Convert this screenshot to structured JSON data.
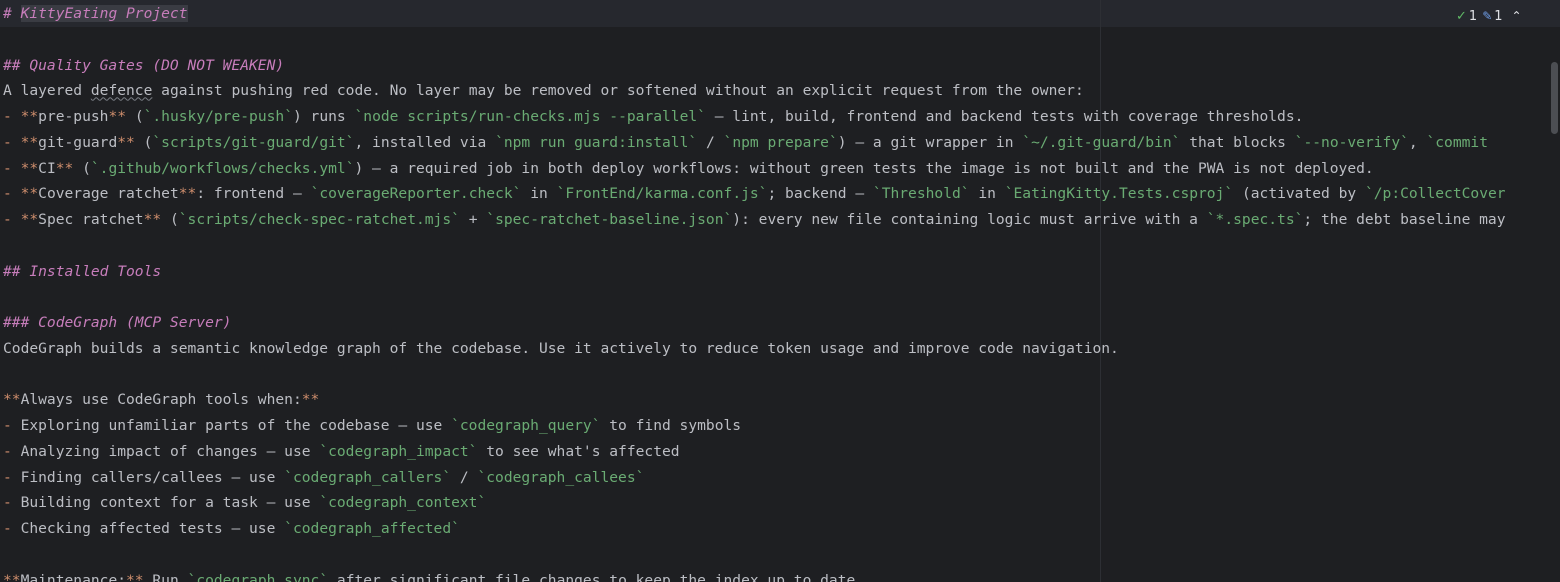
{
  "editor": {
    "lines": [
      [
        {
          "t": "# ",
          "c": "hdr"
        },
        {
          "t": "KittyEating Project",
          "c": "hdr sel"
        }
      ],
      [],
      [
        {
          "t": "## Quality Gates (DO NOT WEAKEN)",
          "c": "hdr"
        }
      ],
      [
        {
          "t": "A layered "
        },
        {
          "t": "defence",
          "c": "uline"
        },
        {
          "t": " against pushing red code. No layer may be removed or softened without an explicit request from the owner:"
        }
      ],
      [
        {
          "t": "- ",
          "c": "mk"
        },
        {
          "t": "**",
          "c": "mk"
        },
        {
          "t": "pre-push"
        },
        {
          "t": "**",
          "c": "mk"
        },
        {
          "t": " ("
        },
        {
          "t": "`.husky/pre-push`",
          "c": "code"
        },
        {
          "t": ") runs "
        },
        {
          "t": "`node scripts/run-checks.mjs --parallel`",
          "c": "code"
        },
        {
          "t": " — lint, build, frontend and backend tests with coverage thresholds."
        }
      ],
      [
        {
          "t": "- ",
          "c": "mk"
        },
        {
          "t": "**",
          "c": "mk"
        },
        {
          "t": "git-guard"
        },
        {
          "t": "**",
          "c": "mk"
        },
        {
          "t": " ("
        },
        {
          "t": "`scripts/git-guard/git`",
          "c": "code"
        },
        {
          "t": ", installed via "
        },
        {
          "t": "`npm run guard:install`",
          "c": "code"
        },
        {
          "t": " / "
        },
        {
          "t": "`npm prepare`",
          "c": "code"
        },
        {
          "t": ") — a git wrapper in "
        },
        {
          "t": "`~/.git-guard/bin`",
          "c": "code"
        },
        {
          "t": " that blocks "
        },
        {
          "t": "`--no-verify`",
          "c": "code"
        },
        {
          "t": ", "
        },
        {
          "t": "`commit",
          "c": "code"
        }
      ],
      [
        {
          "t": "- ",
          "c": "mk"
        },
        {
          "t": "**",
          "c": "mk"
        },
        {
          "t": "CI"
        },
        {
          "t": "**",
          "c": "mk"
        },
        {
          "t": " ("
        },
        {
          "t": "`.github/workflows/checks.yml`",
          "c": "code"
        },
        {
          "t": ") — a required job in both deploy workflows: without green tests the image is not built and the PWA is not deployed."
        }
      ],
      [
        {
          "t": "- ",
          "c": "mk"
        },
        {
          "t": "**",
          "c": "mk"
        },
        {
          "t": "Coverage ratchet"
        },
        {
          "t": "**",
          "c": "mk"
        },
        {
          "t": ": frontend — "
        },
        {
          "t": "`coverageReporter.check`",
          "c": "code"
        },
        {
          "t": " in "
        },
        {
          "t": "`FrontEnd/karma.conf.js`",
          "c": "code"
        },
        {
          "t": "; backend — "
        },
        {
          "t": "`Threshold`",
          "c": "code"
        },
        {
          "t": " in "
        },
        {
          "t": "`EatingKitty.Tests.csproj`",
          "c": "code"
        },
        {
          "t": " (activated by "
        },
        {
          "t": "`/p:CollectCover",
          "c": "code"
        }
      ],
      [
        {
          "t": "- ",
          "c": "mk"
        },
        {
          "t": "**",
          "c": "mk"
        },
        {
          "t": "Spec ratchet"
        },
        {
          "t": "**",
          "c": "mk"
        },
        {
          "t": " ("
        },
        {
          "t": "`scripts/check-spec-ratchet.mjs`",
          "c": "code"
        },
        {
          "t": " + "
        },
        {
          "t": "`spec-ratchet-baseline.json`",
          "c": "code"
        },
        {
          "t": "): every new file containing logic must arrive with a "
        },
        {
          "t": "`*.spec.ts`",
          "c": "code"
        },
        {
          "t": "; the debt baseline may"
        }
      ],
      [],
      [
        {
          "t": "## Installed Tools",
          "c": "hdr"
        }
      ],
      [],
      [
        {
          "t": "### CodeGraph (MCP Server)",
          "c": "hdr"
        }
      ],
      [
        {
          "t": "CodeGraph builds a semantic knowledge graph of the codebase. Use it actively to reduce token usage and improve code navigation."
        }
      ],
      [],
      [
        {
          "t": "**",
          "c": "mk"
        },
        {
          "t": "Always use CodeGraph tools when:"
        },
        {
          "t": "**",
          "c": "mk"
        }
      ],
      [
        {
          "t": "- ",
          "c": "mk"
        },
        {
          "t": "Exploring unfamiliar parts of the codebase — use "
        },
        {
          "t": "`codegraph_query`",
          "c": "code"
        },
        {
          "t": " to find symbols"
        }
      ],
      [
        {
          "t": "- ",
          "c": "mk"
        },
        {
          "t": "Analyzing impact of changes — use "
        },
        {
          "t": "`codegraph_impact`",
          "c": "code"
        },
        {
          "t": " to see what's affected"
        }
      ],
      [
        {
          "t": "- ",
          "c": "mk"
        },
        {
          "t": "Finding callers/callees — use "
        },
        {
          "t": "`codegraph_callers`",
          "c": "code"
        },
        {
          "t": " / "
        },
        {
          "t": "`codegraph_callees`",
          "c": "code"
        }
      ],
      [
        {
          "t": "- ",
          "c": "mk"
        },
        {
          "t": "Building context for a task — use "
        },
        {
          "t": "`codegraph_context`",
          "c": "code"
        }
      ],
      [
        {
          "t": "- ",
          "c": "mk"
        },
        {
          "t": "Checking affected tests — use "
        },
        {
          "t": "`codegraph_affected`",
          "c": "code"
        }
      ],
      [],
      [
        {
          "t": "**",
          "c": "mk"
        },
        {
          "t": "Maintenance:"
        },
        {
          "t": "**",
          "c": "mk"
        },
        {
          "t": " Run "
        },
        {
          "t": "`codegraph sync`",
          "c": "code"
        },
        {
          "t": " after significant file changes to keep the index up to date."
        }
      ]
    ]
  },
  "inspection": {
    "checks_count": "1",
    "typos_count": "1",
    "check_icon": "check-icon",
    "typo_icon": "pen-icon"
  },
  "colors": {
    "background": "#1e1f22",
    "text": "#bcbec4",
    "header": "#c77dbb",
    "markup": "#cf8e6d",
    "inline_code": "#6aab73"
  }
}
